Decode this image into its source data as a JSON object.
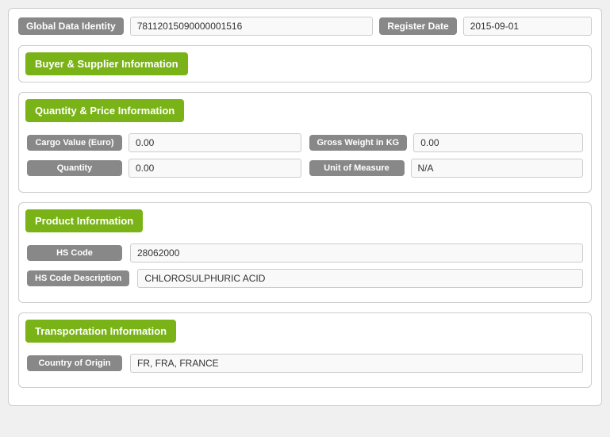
{
  "header": {
    "gdi_label": "Global Data Identity",
    "gdi_value": "78112015090000001516",
    "register_date_label": "Register Date",
    "register_date_value": "2015-09-01"
  },
  "sections": {
    "buyer_supplier": {
      "title": "Buyer & Supplier Information"
    },
    "quantity_price": {
      "title": "Quantity & Price Information",
      "fields": [
        {
          "label": "Cargo Value (Euro)",
          "value": "0.00",
          "label2": "Gross Weight in KG",
          "value2": "0.00"
        },
        {
          "label": "Quantity",
          "value": "0.00",
          "label2": "Unit of Measure",
          "value2": "N/A"
        }
      ]
    },
    "product": {
      "title": "Product Information",
      "hs_code_label": "HS Code",
      "hs_code_value": "28062000",
      "hs_desc_label": "HS Code Description",
      "hs_desc_value": "CHLOROSULPHURIC ACID"
    },
    "transportation": {
      "title": "Transportation Information",
      "country_label": "Country of Origin",
      "country_value": "FR, FRA, FRANCE"
    }
  }
}
